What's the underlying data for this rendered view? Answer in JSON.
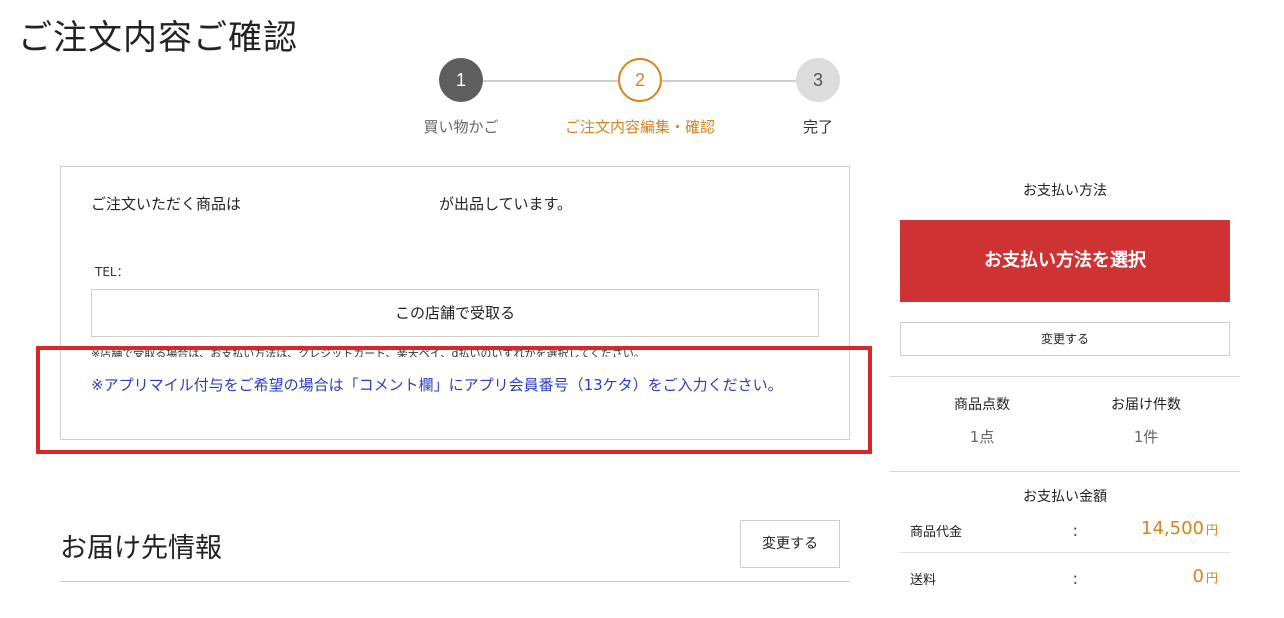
{
  "page": {
    "title": "ご注文内容ご確認"
  },
  "stepper": {
    "steps": [
      {
        "number": "1",
        "label": "買い物かご",
        "state": "done"
      },
      {
        "number": "2",
        "label": "ご注文内容編集・確認",
        "state": "current"
      },
      {
        "number": "3",
        "label": "完了",
        "state": "todo"
      }
    ]
  },
  "shop": {
    "lead": "ご注文いただく商品は",
    "lead_suffix": "が出品しています。",
    "tel_label": "TEL：",
    "pickup_button": "この店舗で受取る",
    "pickup_note": "※店舗で受取る場合は、お支払い方法は、クレジットカード、楽天ペイ、d払いのいずれかを選択してください。",
    "app_note": "※アプリマイル付与をご希望の場合は「コメント欄」にアプリ会員番号（13ケタ）をご入力ください。"
  },
  "delivery": {
    "title": "お届け先情報",
    "change_button": "変更する"
  },
  "payment": {
    "heading": "お支払い方法",
    "select_button": "お支払い方法を選択",
    "change_button": "変更する",
    "item_count_label": "商品点数",
    "item_count_value": "1点",
    "delivery_count_label": "お届け件数",
    "delivery_count_value": "1件",
    "amount_heading": "お支払い金額",
    "rows": [
      {
        "label": "商品代金",
        "colon": "：",
        "value": "14,500",
        "unit": "円"
      },
      {
        "label": "送料",
        "colon": "：",
        "value": "0",
        "unit": "円"
      }
    ]
  },
  "colors": {
    "accent_orange": "#d9821f",
    "primary_red": "#cf3233",
    "highlight_red": "#d9262b",
    "link_blue": "#2a3fbf"
  }
}
